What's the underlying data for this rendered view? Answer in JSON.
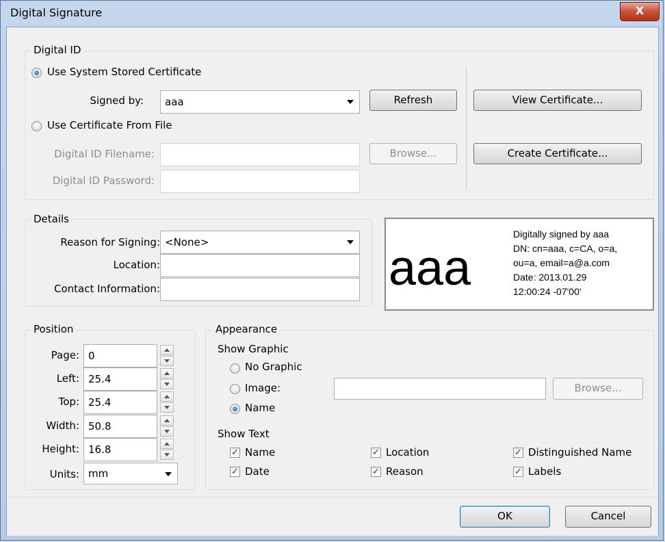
{
  "window": {
    "title": "Digital Signature",
    "close_glyph": "X"
  },
  "digital_id": {
    "legend": "Digital ID",
    "use_system_label": "Use System Stored Certificate",
    "signed_by_label": "Signed by:",
    "signed_by_value": "aaa",
    "refresh_label": "Refresh",
    "view_certificate_label": "View Certificate...",
    "use_file_label": "Use Certificate From File",
    "filename_label": "Digital ID Filename:",
    "filename_value": "",
    "browse_label": "Browse...",
    "create_certificate_label": "Create Certificate...",
    "password_label": "Digital ID Password:",
    "password_value": ""
  },
  "details": {
    "legend": "Details",
    "reason_label": "Reason for Signing:",
    "reason_value": "<None>",
    "location_label": "Location:",
    "location_value": "",
    "contact_label": "Contact Information:",
    "contact_value": ""
  },
  "preview": {
    "name_graphic": "aaa",
    "line1": "Digitally signed by aaa",
    "line2": "DN: cn=aaa, c=CA, o=a,",
    "line3": "ou=a, email=a@a.com",
    "line4": "Date: 2013.01.29",
    "line5": "12:00:24 -07'00'"
  },
  "position": {
    "legend": "Position",
    "page_label": "Page:",
    "page_value": "0",
    "left_label": "Left:",
    "left_value": "25.4",
    "top_label": "Top:",
    "top_value": "25.4",
    "width_label": "Width:",
    "width_value": "50.8",
    "height_label": "Height:",
    "height_value": "16.8",
    "units_label": "Units:",
    "units_value": "mm"
  },
  "appearance": {
    "legend": "Appearance",
    "show_graphic_label": "Show Graphic",
    "no_graphic_label": "No Graphic",
    "image_label": "Image:",
    "image_path_value": "",
    "browse_label": "Browse...",
    "name_label": "Name",
    "show_text_label": "Show Text",
    "cb_name": "Name",
    "cb_location": "Location",
    "cb_distinguished": "Distinguished Name",
    "cb_date": "Date",
    "cb_reason": "Reason",
    "cb_labels": "Labels",
    "check_glyph": "✓"
  },
  "footer": {
    "ok_label": "OK",
    "cancel_label": "Cancel"
  }
}
